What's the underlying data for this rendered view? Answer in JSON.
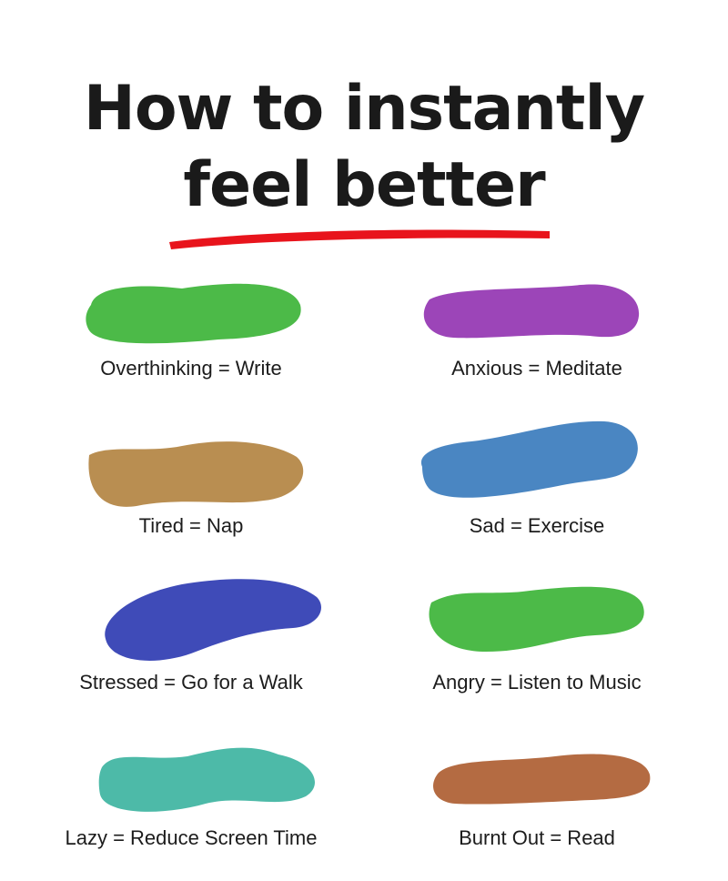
{
  "title": {
    "line1": "How to instantly",
    "line2": "feel better",
    "underline_color": "#e8141c"
  },
  "items": [
    {
      "label": "Overthinking = Write",
      "color": "#4cba48",
      "shape": "blob-a"
    },
    {
      "label": "Anxious = Meditate",
      "color": "#9c45b8",
      "shape": "blob-b"
    },
    {
      "label": "Tired = Nap",
      "color": "#b98e51",
      "shape": "blob-c"
    },
    {
      "label": "Sad = Exercise",
      "color": "#4a86c2",
      "shape": "blob-d"
    },
    {
      "label": "Stressed = Go for a Walk",
      "color": "#3f4bb8",
      "shape": "blob-e"
    },
    {
      "label": "Angry = Listen to Music",
      "color": "#4cba48",
      "shape": "blob-f"
    },
    {
      "label": "Lazy = Reduce Screen Time",
      "color": "#4dbaa8",
      "shape": "blob-g"
    },
    {
      "label": "Burnt Out = Read",
      "color": "#b46b42",
      "shape": "blob-h"
    }
  ]
}
